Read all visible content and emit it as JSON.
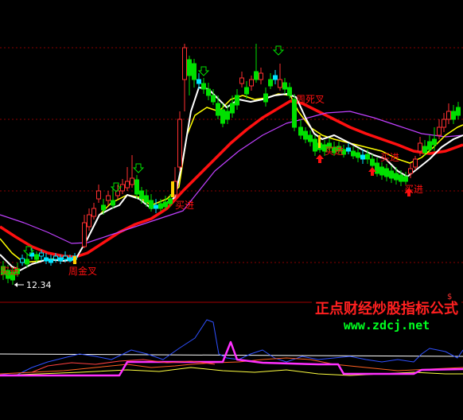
{
  "chart_data": {
    "type": "candlestick",
    "title": "",
    "low_price_label": "12.34",
    "signals": {
      "buy": "买进",
      "golden_cross": "周金叉",
      "death_cross": "周死叉"
    },
    "watermark": {
      "line1": "正点财经炒股指标公式",
      "line2": "www.zdcj.net"
    },
    "colors": {
      "background": "#000000",
      "up_candle": "#ff3030",
      "down_candle": "#00e000",
      "flat_candle": "#00e5ff",
      "ma_white": "#ffffff",
      "ma_yellow": "#ffff00",
      "ma_red": "#ff1010",
      "ma_magenta": "#c040ff",
      "grid": "#8a0000",
      "indicator_magenta": "#ff30ff",
      "indicator_blue": "#3050ff",
      "indicator_yellow": "#ffff40",
      "indicator_orange": "#ff6020",
      "indicator_white": "#ffffff"
    }
  }
}
